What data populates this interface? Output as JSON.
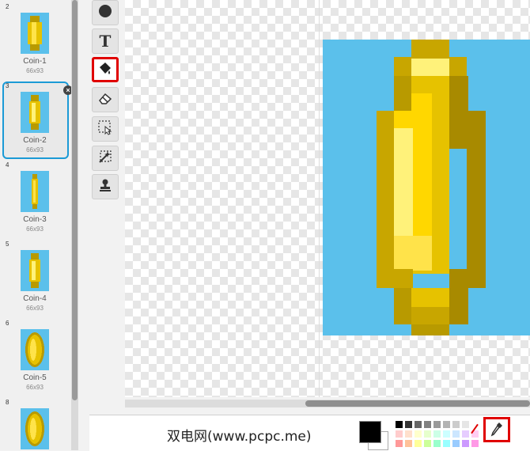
{
  "costumes": [
    {
      "number": "2",
      "name": "Coin-1",
      "size": "66x93",
      "variant": "wide",
      "selected": false
    },
    {
      "number": "3",
      "name": "Coin-2",
      "size": "66x93",
      "variant": "medium",
      "selected": true
    },
    {
      "number": "4",
      "name": "Coin-3",
      "size": "66x93",
      "variant": "thin",
      "selected": false
    },
    {
      "number": "5",
      "name": "Coin-4",
      "size": "66x93",
      "variant": "medium",
      "selected": false
    },
    {
      "number": "6",
      "name": "Coin-5",
      "size": "66x93",
      "variant": "round",
      "selected": false
    },
    {
      "number": "8",
      "name": "",
      "size": "",
      "variant": "round",
      "selected": false
    }
  ],
  "tools": [
    {
      "name": "ellipse-tool",
      "icon": "circle-icon",
      "active": false
    },
    {
      "name": "text-tool",
      "icon": "text-icon",
      "label": "T",
      "active": false
    },
    {
      "name": "fill-tool",
      "icon": "paint-bucket-icon",
      "active": true
    },
    {
      "name": "eraser-tool",
      "icon": "eraser-icon",
      "active": false
    },
    {
      "name": "select-tool",
      "icon": "select-icon",
      "active": false
    },
    {
      "name": "magic-select-tool",
      "icon": "magic-wand-icon",
      "active": false
    },
    {
      "name": "stamp-tool",
      "icon": "stamp-icon",
      "active": false
    }
  ],
  "colors": {
    "sky": "#5bc0eb",
    "primary": "#000000",
    "secondary": "#ffffff",
    "highlight": "#e00000",
    "selection": "#1b9ad6"
  },
  "palette": [
    "#000000",
    "#333333",
    "#666666",
    "#808080",
    "#999999",
    "#b3b3b3",
    "#cccccc",
    "#e6e6e6",
    "#ffffff",
    "#ffcccc",
    "#ffe0cc",
    "#ffffcc",
    "#e6ffcc",
    "#ccffe6",
    "#ccffff",
    "#cce6ff",
    "#e6ccff",
    "#ffccf2",
    "#ff9999",
    "#ffc299",
    "#ffff99",
    "#ccff99",
    "#99ffcc",
    "#99ffff",
    "#99ccff",
    "#cc99ff",
    "#ff99e6"
  ],
  "watermark": "双电网(www.pcpc.me)"
}
